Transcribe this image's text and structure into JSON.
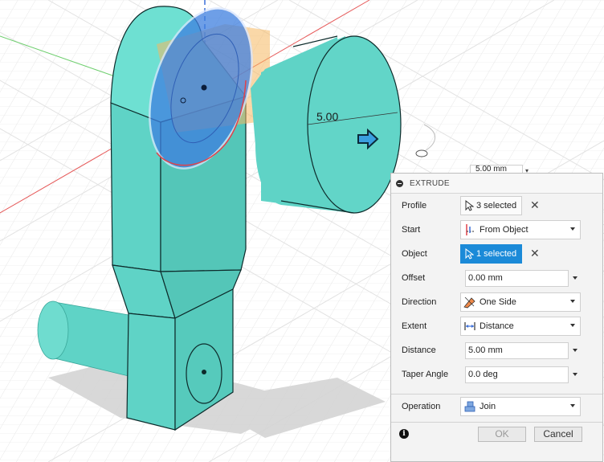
{
  "viewport": {
    "dimension_label": "5.00",
    "dimension_chip": "5.00 mm"
  },
  "panel": {
    "title": "EXTRUDE",
    "profile": {
      "label": "Profile",
      "value": "3 selected"
    },
    "start": {
      "label": "Start",
      "value": "From Object"
    },
    "object": {
      "label": "Object",
      "value": "1 selected"
    },
    "offset": {
      "label": "Offset",
      "value": "0.00 mm"
    },
    "direction": {
      "label": "Direction",
      "value": "One Side"
    },
    "extent": {
      "label": "Extent",
      "value": "Distance"
    },
    "distance": {
      "label": "Distance",
      "value": "5.00 mm"
    },
    "taper": {
      "label": "Taper Angle",
      "value": "0.0 deg"
    },
    "operation": {
      "label": "Operation",
      "value": "Join"
    },
    "ok_label": "OK",
    "cancel_label": "Cancel"
  },
  "colors": {
    "body": "#5fd3c6",
    "selection": "#3e7fe0",
    "accent": "#1b8ad8"
  }
}
